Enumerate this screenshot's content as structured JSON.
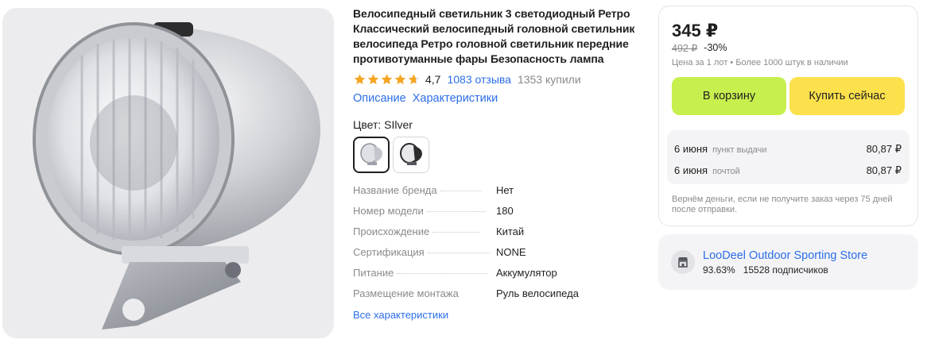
{
  "product": {
    "title": "Велосипедный светильник 3 светодиодный Ретро Классический велосипедный головной светильник велосипеда Ретро головной светильник передние противотуманные фары Безопасность лампа",
    "rating": "4,7",
    "rating_value": 4.7,
    "reviews": "1083 отзыва",
    "purchases": "1353 купили",
    "tabs": [
      "Описание",
      "Характеристики"
    ],
    "color_label": "Цвет: SIlver",
    "specs": [
      {
        "name": "Название бренда",
        "value": "Нет"
      },
      {
        "name": "Номер модели",
        "value": "180"
      },
      {
        "name": "Происхождение",
        "value": "Китай"
      },
      {
        "name": "Сертификация",
        "value": "NONE"
      },
      {
        "name": "Питание",
        "value": "Аккумулятор"
      },
      {
        "name": "Размещение монтажа",
        "value": "Руль велосипеда"
      }
    ],
    "all_specs_link": "Все характеристики"
  },
  "buy": {
    "price": "345 ₽",
    "old_price": "492 ₽",
    "discount": "-30%",
    "stock_note": "Цена за 1 лот • Более 1000 штук в наличии",
    "cart_button": "В корзину",
    "buy_now_button": "Купить сейчас",
    "delivery": [
      {
        "date": "6 июня",
        "method": "пункт выдачи",
        "price": "80,87 ₽"
      },
      {
        "date": "6 июня",
        "method": "почтой",
        "price": "80,87 ₽"
      }
    ],
    "refund_note": "Вернём деньги, если не получите заказ через 75 дней после отправки."
  },
  "store": {
    "name": "LooDeel Outdoor Sporting Store",
    "rating": "93.63%",
    "subscribers": "15528 подписчиков"
  },
  "colors": {
    "link": "#2b6ee8",
    "cart_button": "#c7ef4e",
    "buy_button": "#fde14c",
    "star": "#f5a623",
    "muted": "#8a8a8f"
  }
}
